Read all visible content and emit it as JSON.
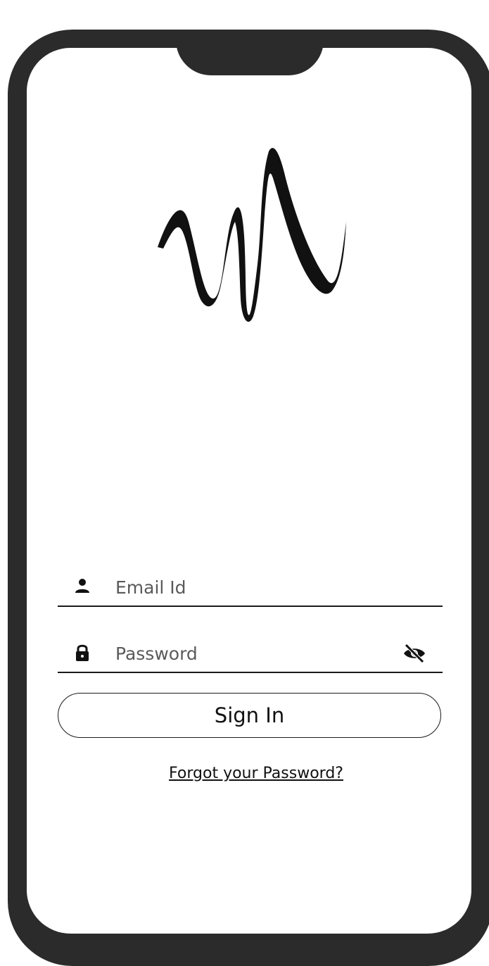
{
  "login": {
    "email": {
      "placeholder": "Email Id",
      "value": ""
    },
    "password": {
      "placeholder": "Password",
      "value": ""
    },
    "signin_label": "Sign In",
    "forgot_label": "Forgot your Password?"
  },
  "icons": {
    "email": "person-icon",
    "password": "lock-icon",
    "toggle": "eye-slash-icon"
  },
  "colors": {
    "frame": "#2b2b2b",
    "screen": "#ffffff",
    "ink": "#111111"
  }
}
